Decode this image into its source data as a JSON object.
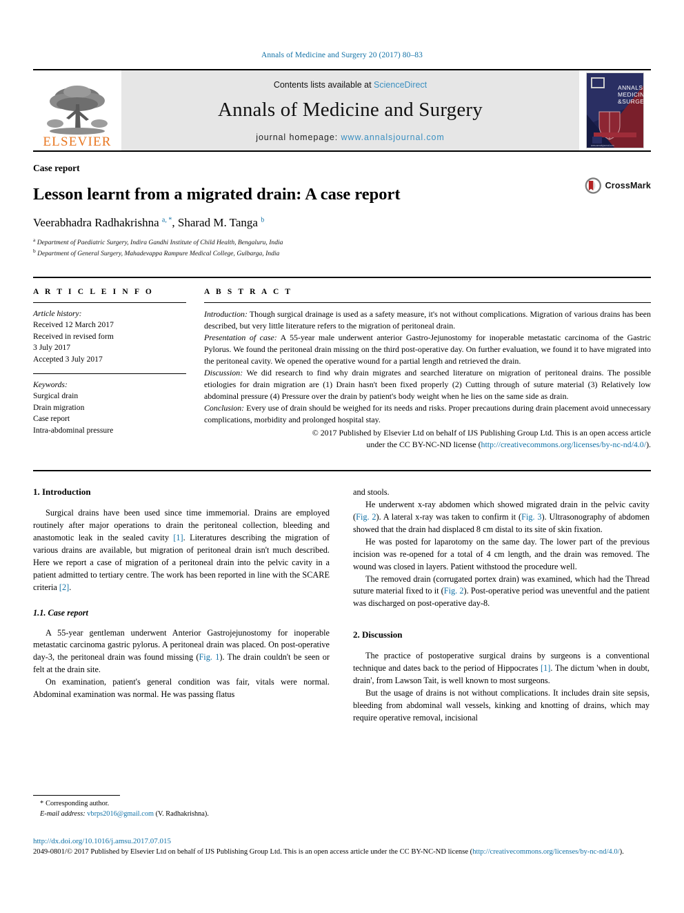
{
  "running_head": "Annals of Medicine and Surgery 20 (2017) 80–83",
  "masthead": {
    "publisher_logo_text": "ELSEVIER",
    "contents_prefix": "Contents lists available at ",
    "contents_link": "ScienceDirect",
    "journal_name": "Annals of Medicine and Surgery",
    "homepage_label": "journal homepage: ",
    "homepage_url": "www.annalsjournal.com",
    "cover": {
      "line1": "ANNALS OF",
      "line2": "MEDICINE",
      "line3": "&SURGERY"
    }
  },
  "article": {
    "doctype": "Case report",
    "title": "Lesson learnt from a migrated drain: A case report",
    "authors_text": "Veerabhadra Radhakrishna ",
    "author1_sup": "a, *",
    "authors_text2": ", Sharad M. Tanga ",
    "author2_sup": "b",
    "affiliations": [
      {
        "marker": "a",
        "text": "Department of Paediatric Surgery, Indira Gandhi Institute of Child Health, Bengaluru, India"
      },
      {
        "marker": "b",
        "text": "Department of General Surgery, Mahadevappa Rampure Medical College, Gulbarga, India"
      }
    ],
    "crossmark_label": "CrossMark"
  },
  "article_info": {
    "heading": "A R T I C L E  I N F O",
    "history_label": "Article history:",
    "history_lines": [
      "Received 12 March 2017",
      "Received in revised form",
      "3 July 2017",
      "Accepted 3 July 2017"
    ],
    "keywords_label": "Keywords:",
    "keywords": [
      "Surgical drain",
      "Drain migration",
      "Case report",
      "Intra-abdominal pressure"
    ]
  },
  "abstract": {
    "heading": "A B S T R A C T",
    "sections": [
      {
        "label": "Introduction:",
        "text": " Though surgical drainage is used as a safety measure, it's not without complications. Migration of various drains has been described, but very little literature refers to the migration of peritoneal drain."
      },
      {
        "label": "Presentation of case:",
        "text": " A 55-year male underwent anterior Gastro-Jejunostomy for inoperable metastatic carcinoma of the Gastric Pylorus. We found the peritoneal drain missing on the third post-operative day. On further evaluation, we found it to have migrated into the peritoneal cavity. We opened the operative wound for a partial length and retrieved the drain."
      },
      {
        "label": "Discussion:",
        "text": " We did research to find why drain migrates and searched literature on migration of peritoneal drains. The possible etiologies for drain migration are (1) Drain hasn't been fixed properly (2) Cutting through of suture material (3) Relatively low abdominal pressure (4) Pressure over the drain by patient's body weight when he lies on the same side as drain."
      },
      {
        "label": "Conclusion:",
        "text": " Every use of drain should be weighed for its needs and risks. Proper precautions during drain placement avoid unnecessary complications, morbidity and prolonged hospital stay."
      }
    ],
    "copyright_line1": "© 2017 Published by Elsevier Ltd on behalf of IJS Publishing Group Ltd. This is an open access article",
    "copyright_line2_pre": "under the CC BY-NC-ND license (",
    "copyright_link": "http://creativecommons.org/licenses/by-nc-nd/4.0/",
    "copyright_line2_post": ")."
  },
  "body": {
    "left": {
      "section1_heading": "1. Introduction",
      "p1_a": "Surgical drains have been used since time immemorial. Drains are employed routinely after major operations to drain the peritoneal collection, bleeding and anastomotic leak in the sealed cavity ",
      "p1_ref1": "[1]",
      "p1_b": ". Literatures describing the migration of various drains are available, but migration of peritoneal drain isn't much described. Here we report a case of migration of a peritoneal drain into the pelvic cavity in a patient admitted to tertiary centre. The work has been reported in line with the SCARE criteria ",
      "p1_ref2": "[2]",
      "p1_c": ".",
      "subsection_heading": "1.1. Case report",
      "p2_a": "A 55-year gentleman underwent Anterior Gastrojejunostomy for inoperable metastatic carcinoma gastric pylorus. A peritoneal drain was placed. On post-operative day-3, the peritoneal drain was found missing (",
      "p2_ref": "Fig. 1",
      "p2_b": "). The drain couldn't be seen or felt at the drain site.",
      "p3": "On examination, patient's general condition was fair, vitals were normal. Abdominal examination was normal. He was passing flatus"
    },
    "right": {
      "p4_cont": "and stools.",
      "p5_a": "He underwent x-ray abdomen which showed migrated drain in the pelvic cavity (",
      "p5_ref1": "Fig. 2",
      "p5_b": "). A lateral x-ray was taken to confirm it (",
      "p5_ref2": "Fig. 3",
      "p5_c": "). Ultrasonography of abdomen showed that the drain had displaced 8 cm distal to its site of skin fixation.",
      "p6": "He was posted for laparotomy on the same day. The lower part of the previous incision was re-opened for a total of 4 cm length, and the drain was removed. The wound was closed in layers. Patient withstood the procedure well.",
      "p7_a": "The removed drain (corrugated portex drain) was examined, which had the Thread suture material fixed to it (",
      "p7_ref": "Fig. 2",
      "p7_b": "). Post-operative period was uneventful and the patient was discharged on post-operative day-8.",
      "section2_heading": "2. Discussion",
      "p8_a": "The practice of postoperative surgical drains by surgeons is a conventional technique and dates back to the period of Hippocrates ",
      "p8_ref": "[1]",
      "p8_b": ". The dictum 'when in doubt, drain', from Lawson Tait, is well known to most surgeons.",
      "p9": "But the usage of drains is not without complications. It includes drain site sepsis, bleeding from abdominal wall vessels, kinking and knotting of drains, which may require operative removal, incisional"
    }
  },
  "footnotes": {
    "corresponding_marker": "*",
    "corresponding_text": "Corresponding author.",
    "email_label": "E-mail address:",
    "email": "vbrps2016@gmail.com",
    "email_owner": "(V. Radhakrishna)."
  },
  "page_footer": {
    "doi": "http://dx.doi.org/10.1016/j.amsu.2017.07.015",
    "license_pre": "2049-0801/© 2017 Published by Elsevier Ltd on behalf of IJS Publishing Group Ltd. This is an open access article under the CC BY-NC-ND license (",
    "license_link": "http://creativecommons.org/licenses/by-nc-nd/4.0/",
    "license_post": ")."
  },
  "colors": {
    "link": "#1171a6",
    "elsevier_orange": "#E87722",
    "band_gray": "#e6e6e6"
  }
}
